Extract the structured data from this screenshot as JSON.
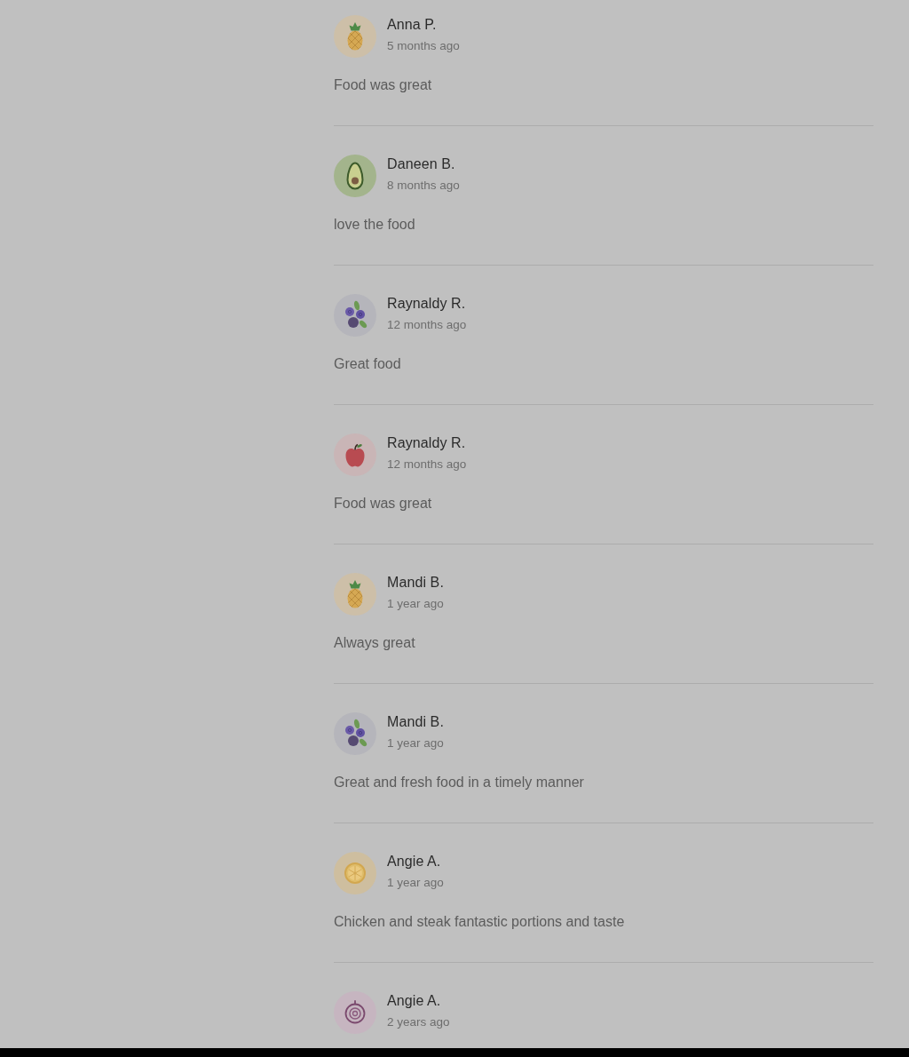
{
  "reviews": [
    {
      "author": "Anna P.",
      "time": "5 months ago",
      "comment": "Food was great",
      "avatar": {
        "kind": "pineapple"
      }
    },
    {
      "author": "Daneen B.",
      "time": "8 months ago",
      "comment": "love the food",
      "avatar": {
        "kind": "avocado"
      }
    },
    {
      "author": "Raynaldy R.",
      "time": "12 months ago",
      "comment": "Great food",
      "avatar": {
        "kind": "blueberries"
      }
    },
    {
      "author": "Raynaldy R.",
      "time": "12 months ago",
      "comment": "Food was great",
      "avatar": {
        "kind": "apple"
      }
    },
    {
      "author": "Mandi B.",
      "time": "1 year ago",
      "comment": "Always great",
      "avatar": {
        "kind": "pineapple"
      }
    },
    {
      "author": "Mandi B.",
      "time": "1 year ago",
      "comment": "Great and fresh food in a timely manner",
      "avatar": {
        "kind": "blueberries"
      }
    },
    {
      "author": "Angie A.",
      "time": "1 year ago",
      "comment": "Chicken and steak fantastic portions and taste",
      "avatar": {
        "kind": "citrus-slice"
      }
    },
    {
      "author": "Angie A.",
      "time": "2 years ago",
      "avatar": {
        "kind": "onion"
      }
    }
  ]
}
